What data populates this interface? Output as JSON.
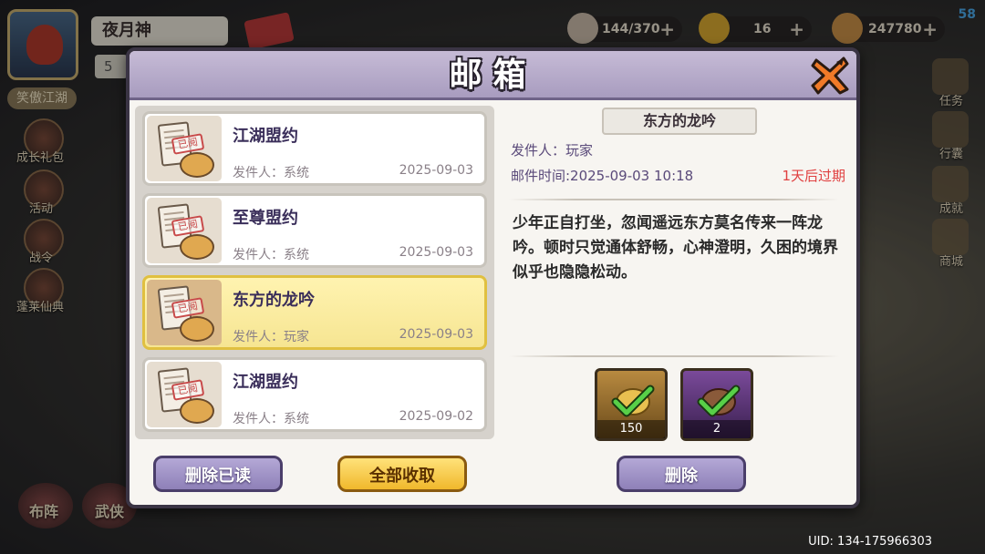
{
  "hud": {
    "player_name": "夜月神",
    "level": "5",
    "realm": "笑傲江湖",
    "fps": "58",
    "uid": "UID: 134-175966303",
    "resources": [
      {
        "value": "144/370",
        "icon": "food-icon",
        "color": "#c8b8a8"
      },
      {
        "value": "16",
        "icon": "gold-ingot-icon",
        "color": "#d8a830"
      },
      {
        "value": "247780",
        "icon": "coin-icon",
        "color": "#c89048"
      }
    ],
    "left_menu": [
      {
        "label": "成长礼包",
        "icon": "gift-icon"
      },
      {
        "label": "活动",
        "icon": "event-icon"
      },
      {
        "label": "战令",
        "icon": "battle-pass-icon"
      },
      {
        "label": "蓬莱仙典",
        "icon": "scroll-icon"
      }
    ],
    "right_menu": [
      {
        "label": "任务",
        "icon": "quest-icon"
      },
      {
        "label": "行囊",
        "icon": "bag-icon"
      },
      {
        "label": "成就",
        "icon": "achievement-icon"
      },
      {
        "label": "商城",
        "icon": "shop-icon"
      }
    ],
    "bottom_menu": [
      {
        "label": "布阵",
        "icon": "formation-icon"
      },
      {
        "label": "武侠",
        "icon": "hero-icon"
      }
    ]
  },
  "mailbox": {
    "title": "邮箱",
    "read_stamp": "已阅",
    "mails": [
      {
        "title": "江湖盟约",
        "sender": "发件人：系统",
        "date": "2025-09-03",
        "selected": false
      },
      {
        "title": "至尊盟约",
        "sender": "发件人：系统",
        "date": "2025-09-03",
        "selected": false
      },
      {
        "title": "东方的龙吟",
        "sender": "发件人：玩家",
        "date": "2025-09-03",
        "selected": true
      },
      {
        "title": "江湖盟约",
        "sender": "发件人：系统",
        "date": "2025-09-02",
        "selected": false
      }
    ],
    "detail": {
      "title": "东方的龙吟",
      "sender": "发件人：玩家",
      "time": "邮件时间:2025-09-03 10:18",
      "expire": "1天后过期",
      "content": "少年正自打坐，忽闻遥远东方莫名传来一阵龙吟。顿时只觉通体舒畅，心神澄明，久困的境界似乎也隐隐松动。",
      "rewards": [
        {
          "icon": "gold-leaf-icon",
          "count": "150",
          "claimed": true
        },
        {
          "icon": "purple-beast-icon",
          "count": "2",
          "claimed": true
        }
      ]
    },
    "buttons": {
      "delete_read": "删除已读",
      "claim_all": "全部收取",
      "delete": "删除"
    }
  }
}
